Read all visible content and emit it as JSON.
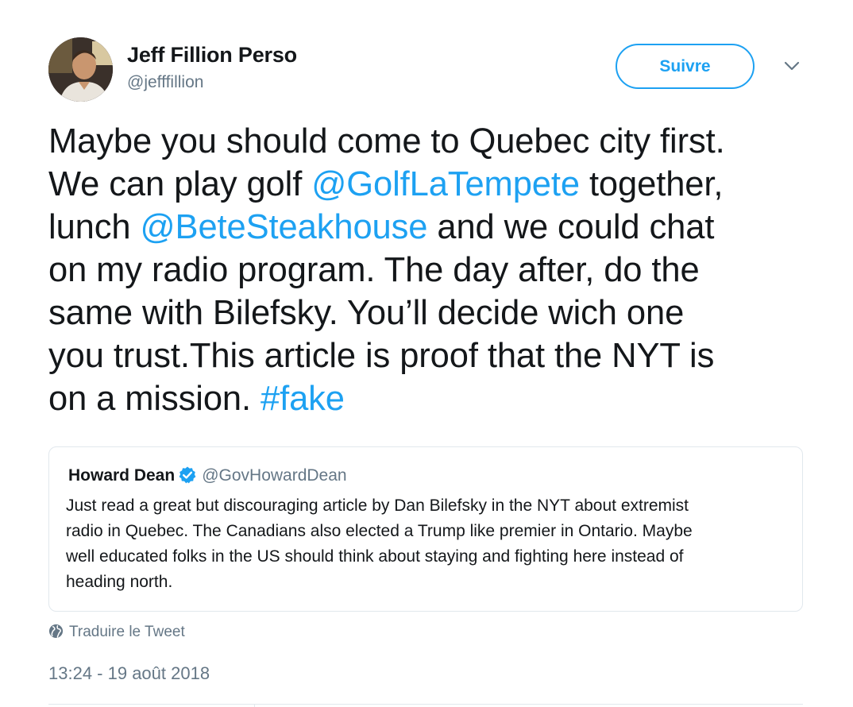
{
  "author": {
    "name": "Jeff Fillion Perso",
    "handle": "@jefffillion"
  },
  "actions": {
    "follow_label": "Suivre",
    "menu_icon": "chevron-down-icon"
  },
  "tweet": {
    "lines": [
      [
        {
          "text": "Maybe you should come to Quebec city first."
        }
      ],
      [
        {
          "text": "We can play golf "
        },
        {
          "text": "@GolfLaTempete",
          "link": true
        },
        {
          "text": " together,"
        }
      ],
      [
        {
          "text": "lunch "
        },
        {
          "text": "@BeteSteakhouse",
          "link": true
        },
        {
          "text": " and we could chat"
        }
      ],
      [
        {
          "text": "on my radio program. The day after, do the"
        }
      ],
      [
        {
          "text": "same with Bilefsky. You’ll decide wich one"
        }
      ],
      [
        {
          "text": "you trust.This article is proof that the NYT is"
        }
      ],
      [
        {
          "text": "on a mission. "
        },
        {
          "text": "#fake",
          "link": true
        }
      ]
    ]
  },
  "quoted_tweet": {
    "name": "Howard Dean",
    "verified_icon": "verified-badge-icon",
    "handle": "@GovHowardDean",
    "lines": [
      "Just read a great but discouraging article by Dan Bilefsky in the NYT about extremist",
      "radio in Quebec. The Canadians also elected a Trump like premier in Ontario. Maybe",
      "well educated folks in the US should think about staying and fighting here instead of",
      "heading north."
    ]
  },
  "translate": {
    "icon": "globe-icon",
    "label": "Traduire le Tweet"
  },
  "timestamp": "13:24 - 19 août 2018",
  "colors": {
    "accent": "#1da1f2",
    "text": "#14171a",
    "muted": "#657786",
    "border": "#e1e8ed"
  }
}
